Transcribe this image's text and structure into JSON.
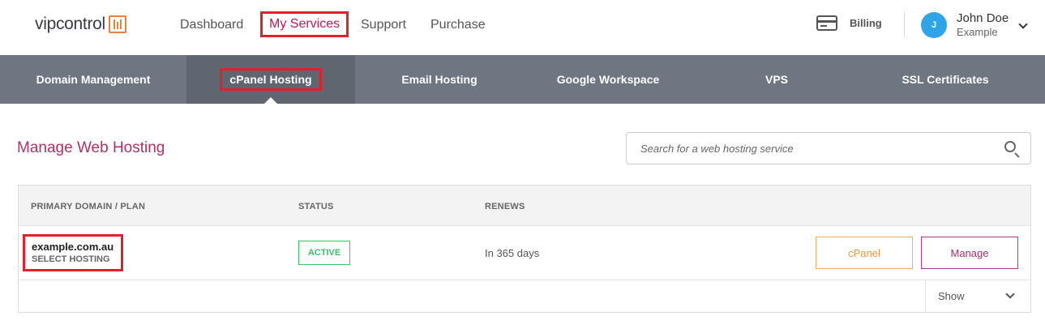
{
  "brand": {
    "logo_text": "vipcontrol",
    "logo_icon": "sliders-icon",
    "accent": "#e8813a"
  },
  "header": {
    "nav": [
      {
        "label": "Dashboard"
      },
      {
        "label": "My Services",
        "active": true
      },
      {
        "label": "Support"
      },
      {
        "label": "Purchase"
      }
    ],
    "billing_label": "Billing",
    "billing_icon": "credit-card-icon",
    "user": {
      "initial": "J",
      "name": "John Doe",
      "subtitle": "Example"
    }
  },
  "subnav": {
    "items": [
      {
        "label": "Domain Management"
      },
      {
        "label": "cPanel Hosting",
        "active": true
      },
      {
        "label": "Email Hosting"
      },
      {
        "label": "Google Workspace"
      },
      {
        "label": "VPS"
      },
      {
        "label": "SSL Certificates"
      }
    ],
    "background": "#6e7681"
  },
  "main": {
    "title": "Manage Web Hosting",
    "search_placeholder": "Search for a web hosting service",
    "table": {
      "headers": [
        "PRIMARY DOMAIN / PLAN",
        "STATUS",
        "RENEWS"
      ],
      "rows": [
        {
          "domain": "example.com.au",
          "plan": "SELECT HOSTING",
          "status": "ACTIVE",
          "renews": "In 365 days",
          "actions": [
            "cPanel",
            "Manage"
          ]
        }
      ],
      "show_label": "Show"
    }
  },
  "colors": {
    "title": "#b0306a",
    "active_status": "#3bbf6a",
    "highlight": "#e0202b"
  }
}
